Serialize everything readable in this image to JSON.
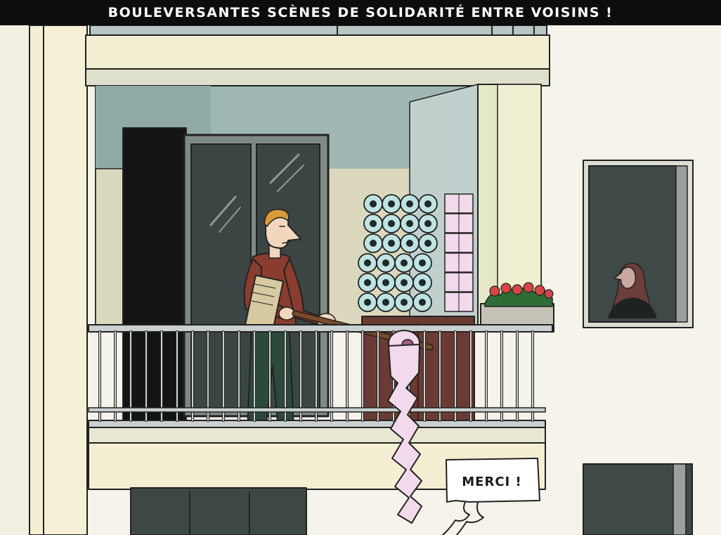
{
  "caption": {
    "title": "BOULEVERSANTES SCÈNES DE SOLIDARITÉ ENTRE VOISINS !"
  },
  "speech_bubble": {
    "text": "MERCI !"
  },
  "colors": {
    "title_bar_bg": "#0d0d0d",
    "facade_cream": "#f4efd2",
    "balcony_wall": "#9cb5b2",
    "door_dark": "#2f3a38",
    "sweater": "#8a3c2e",
    "toilet_paper": "#f3d9ec",
    "toilet_roll_blue": "#bfe3e3",
    "flowers": "#d64545",
    "window_frame": "#8a8f8c"
  }
}
